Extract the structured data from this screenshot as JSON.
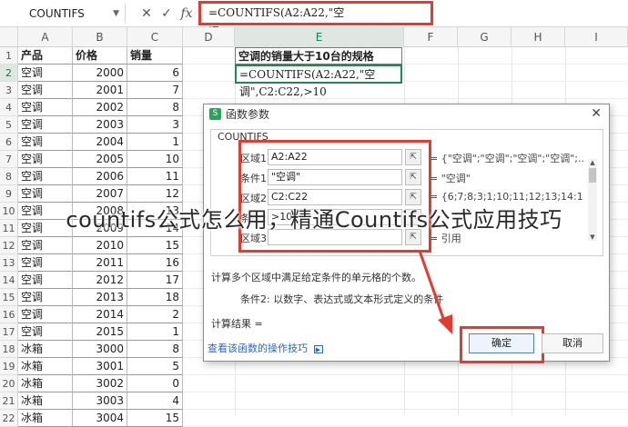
{
  "formula_bar": {
    "name_box": "COUNTIFS",
    "icons": [
      "x-icon",
      "check-icon",
      "fx-icon"
    ],
    "formula": "=COUNTIFS(A2:A22,\"空调\",C2:C22,>10"
  },
  "columns": [
    "A",
    "B",
    "C",
    "D",
    "E",
    "F",
    "G",
    "H",
    "I"
  ],
  "header_row": {
    "cat": "产品",
    "price": "价格",
    "sales": "销量"
  },
  "rows": [
    {
      "n": "2",
      "cat": "空调",
      "price": "2000",
      "sales": "6"
    },
    {
      "n": "3",
      "cat": "空调",
      "price": "2001",
      "sales": "7"
    },
    {
      "n": "4",
      "cat": "空调",
      "price": "2002",
      "sales": "8"
    },
    {
      "n": "5",
      "cat": "空调",
      "price": "2003",
      "sales": "3"
    },
    {
      "n": "6",
      "cat": "空调",
      "price": "2004",
      "sales": "1"
    },
    {
      "n": "7",
      "cat": "空调",
      "price": "2005",
      "sales": "10"
    },
    {
      "n": "8",
      "cat": "空调",
      "price": "2006",
      "sales": "11"
    },
    {
      "n": "9",
      "cat": "空调",
      "price": "2007",
      "sales": "12"
    },
    {
      "n": "10",
      "cat": "空调",
      "price": "2008",
      "sales": "13"
    },
    {
      "n": "11",
      "cat": "空调",
      "price": "2009",
      "sales": "14"
    },
    {
      "n": "12",
      "cat": "空调",
      "price": "2010",
      "sales": "15"
    },
    {
      "n": "13",
      "cat": "空调",
      "price": "2011",
      "sales": "16"
    },
    {
      "n": "14",
      "cat": "空调",
      "price": "2012",
      "sales": "17"
    },
    {
      "n": "15",
      "cat": "空调",
      "price": "2013",
      "sales": "18"
    },
    {
      "n": "16",
      "cat": "空调",
      "price": "2014",
      "sales": "2"
    },
    {
      "n": "17",
      "cat": "空调",
      "price": "2015",
      "sales": "1"
    },
    {
      "n": "18",
      "cat": "冰箱",
      "price": "3000",
      "sales": "8"
    },
    {
      "n": "19",
      "cat": "冰箱",
      "price": "3001",
      "sales": "5"
    },
    {
      "n": "20",
      "cat": "冰箱",
      "price": "3002",
      "sales": "0"
    },
    {
      "n": "21",
      "cat": "冰箱",
      "price": "3003",
      "sales": "4"
    },
    {
      "n": "22",
      "cat": "冰箱",
      "price": "3004",
      "sales": "15"
    }
  ],
  "cell_e1": "空调的销量大于10台的规格",
  "cell_e2": "=COUNTIFS(A2:A22,\"空调\",C2:C22,>10",
  "dialog": {
    "title": "函数参数",
    "function_name": "COUNTIFS",
    "args": [
      {
        "label": "区域1",
        "value": "A2:A22",
        "result": "= {\"空调\";\"空调\";\"空调\";\"空调\";..."
      },
      {
        "label": "条件1",
        "value": "\"空调\"",
        "result": "= \"空调\""
      },
      {
        "label": "区域2",
        "value": "C2:C22",
        "result": "= {6;7;8;3;1;10;11;12;13;14:1..."
      },
      {
        "label": "条件2",
        "value": ">10",
        "result": ""
      },
      {
        "label": "区域3",
        "value": "",
        "result": "= 引用"
      }
    ],
    "description": "计算多个区域中满足给定条件的单元格的个数。",
    "arg_help": "条件2:  以数字、表达式或文本形式定义的条件",
    "result_label": "计算结果 =",
    "tips_link": "查看该函数的操作技巧",
    "ok_label": "确定",
    "cancel_label": "取消"
  },
  "caption": "countifs公式怎么用，精通Countifs公式应用技巧",
  "colors": {
    "highlight": "#e53b2e",
    "accent_green": "#1e8a50",
    "link": "#2a67c4"
  }
}
